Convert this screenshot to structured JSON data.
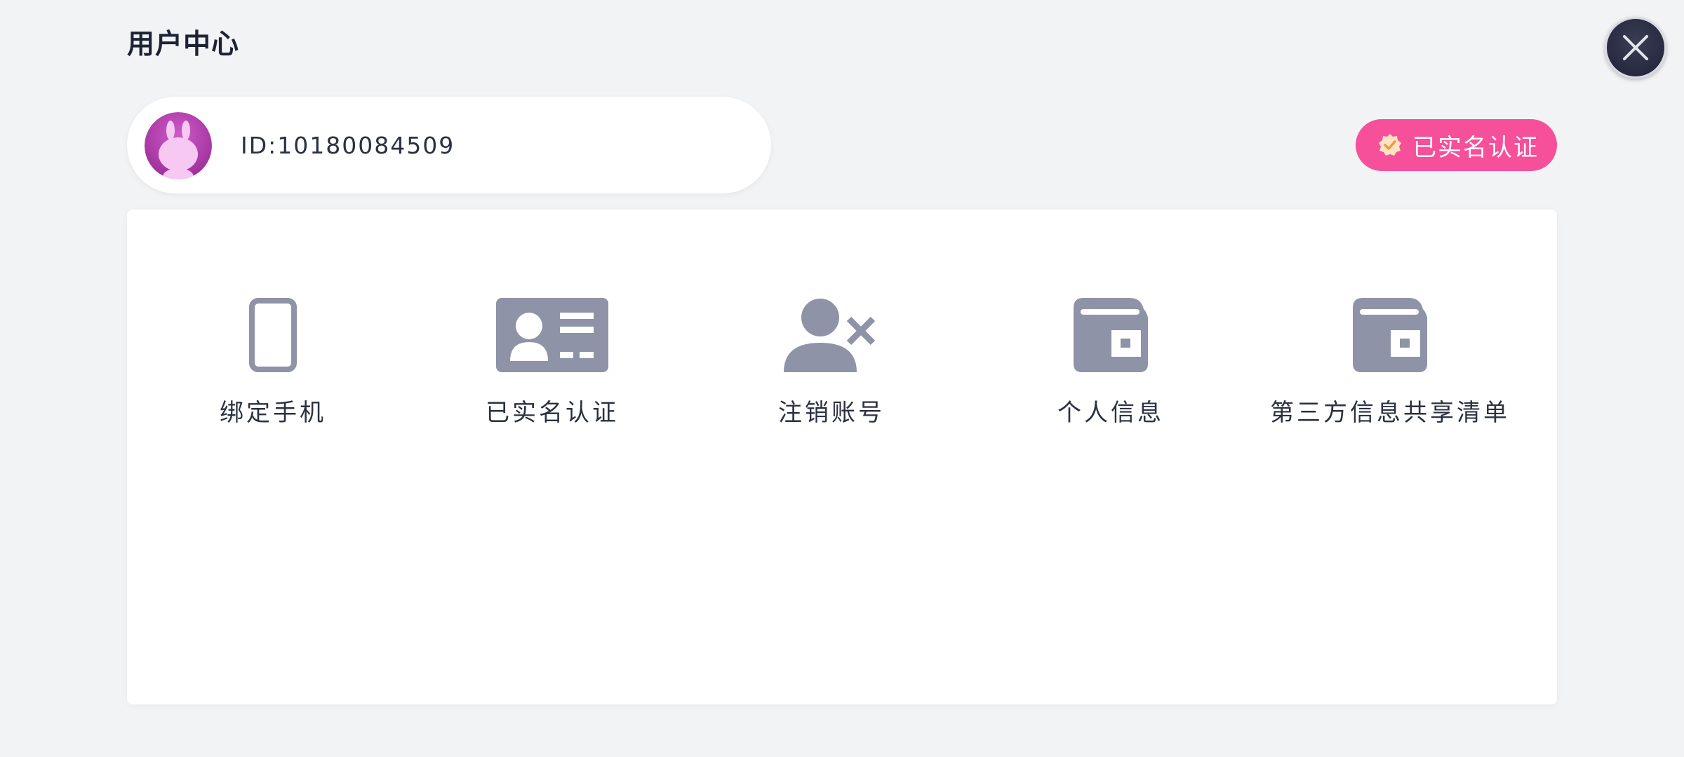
{
  "header": {
    "title": "用户中心"
  },
  "profile": {
    "user_id": "ID:10180084509",
    "verified_label": "已实名认证"
  },
  "menu": {
    "items": [
      {
        "label": "绑定手机",
        "icon": "phone-icon"
      },
      {
        "label": "已实名认证",
        "icon": "id-card-icon"
      },
      {
        "label": "注销账号",
        "icon": "user-remove-icon"
      },
      {
        "label": "个人信息",
        "icon": "wallet-icon"
      },
      {
        "label": "第三方信息共享清单",
        "icon": "wallet-icon"
      }
    ]
  },
  "colors": {
    "background": "#f2f3f5",
    "accent": "#f6509a",
    "icon": "#8e93a7",
    "text": "#1f2535"
  }
}
